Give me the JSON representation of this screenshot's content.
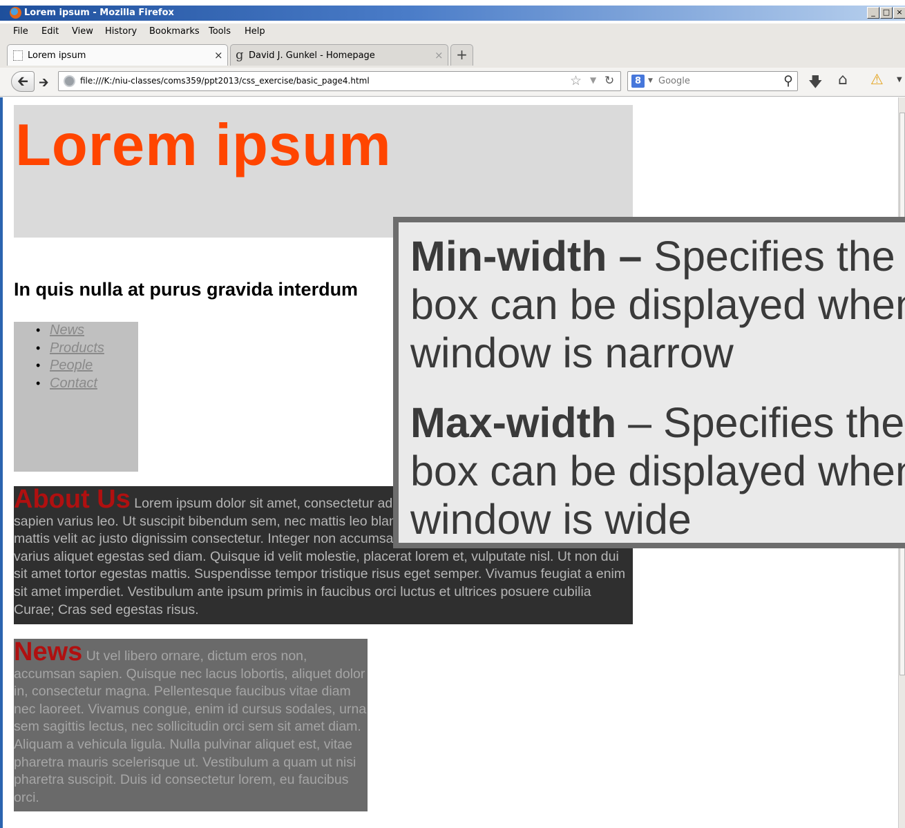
{
  "window": {
    "title": "Lorem ipsum - Mozilla Firefox",
    "minimize_label": "_",
    "maximize_label": "□",
    "close_label": "×"
  },
  "menu": {
    "items": [
      "File",
      "Edit",
      "View",
      "History",
      "Bookmarks",
      "Tools",
      "Help"
    ]
  },
  "tabs": [
    {
      "label": "Lorem ipsum",
      "close": "×"
    },
    {
      "label": "David J. Gunkel - Homepage",
      "close": "×"
    }
  ],
  "new_tab_label": "+",
  "navbar": {
    "url": "file:///K:/niu-classes/coms359/ppt2013/css_exercise/basic_page4.html",
    "search_engine_badge": "8",
    "search_placeholder": "Google"
  },
  "page": {
    "header_title": "Lorem ipsum",
    "subheading": "In quis nulla at purus gravida interdum",
    "nav_links": [
      "News",
      "Products",
      "People",
      "Contact"
    ],
    "about": {
      "heading": "About Us",
      "body": " Lorem ipsum dolor sit amet, consectetur adipiscing elit. Donec vel orci sit amet sapien varius leo. Ut suscipit bibendum sem, nec mattis leo blandit in. Ut dignissim, quam a pharetra mattis velit ac justo dignissim consectetur. Integer non accumsan tellus. Nullam blandit lorem id odio varius aliquet egestas sed diam. Quisque id velit molestie, placerat lorem et, vulputate nisl. Ut non dui sit amet tortor egestas mattis. Suspendisse tempor tristique risus eget semper. Vivamus feugiat a enim sit amet imperdiet. Vestibulum ante ipsum primis in faucibus orci luctus et ultrices posuere cubilia Curae; Cras sed egestas risus."
    },
    "news": {
      "heading": "News",
      "body": " Ut vel libero ornare, dictum eros non, accumsan sapien. Quisque nec lacus lobortis, aliquet dolor in, consectetur magna. Pellentesque faucibus vitae diam nec laoreet. Vivamus congue, enim id cursus sodales, urna sem sagittis lectus, nec sollicitudin orci sem sit amet diam. Aliquam a vehicula ligula. Nulla pulvinar aliquet est, vitae pharetra mauris scelerisque ut. Vestibulum a quam ut nisi pharetra suscipit. Duis id consectetur lorem, eu faucibus orci."
    }
  },
  "callout": {
    "min_term": "Min-width –",
    "min_line1": " Specifies the s",
    "min_line2": "box can be displayed when",
    "min_line3": "window is narrow",
    "max_term": "Max-width",
    "max_line1": " – Specifies the l",
    "max_line2": "box can be displayed when",
    "max_line3": "window is wide"
  },
  "icons": {
    "firefox_logo": "firefox-logo-icon",
    "back": "back-arrow-icon",
    "forward": "forward-arrow-icon",
    "globe": "globe-icon",
    "bookmark_star": "star-icon",
    "reload": "reload-icon",
    "search": "magnifier-icon",
    "download": "download-icon",
    "home": "home-icon",
    "warning": "warning-icon"
  },
  "colors": {
    "header_title": "#ff4500",
    "section_heading": "#b01010",
    "header_bg": "#dadada",
    "nav_bg": "#c0c0c0",
    "about_bg": "#2f2f2f",
    "news_bg": "#6a6a6a"
  }
}
